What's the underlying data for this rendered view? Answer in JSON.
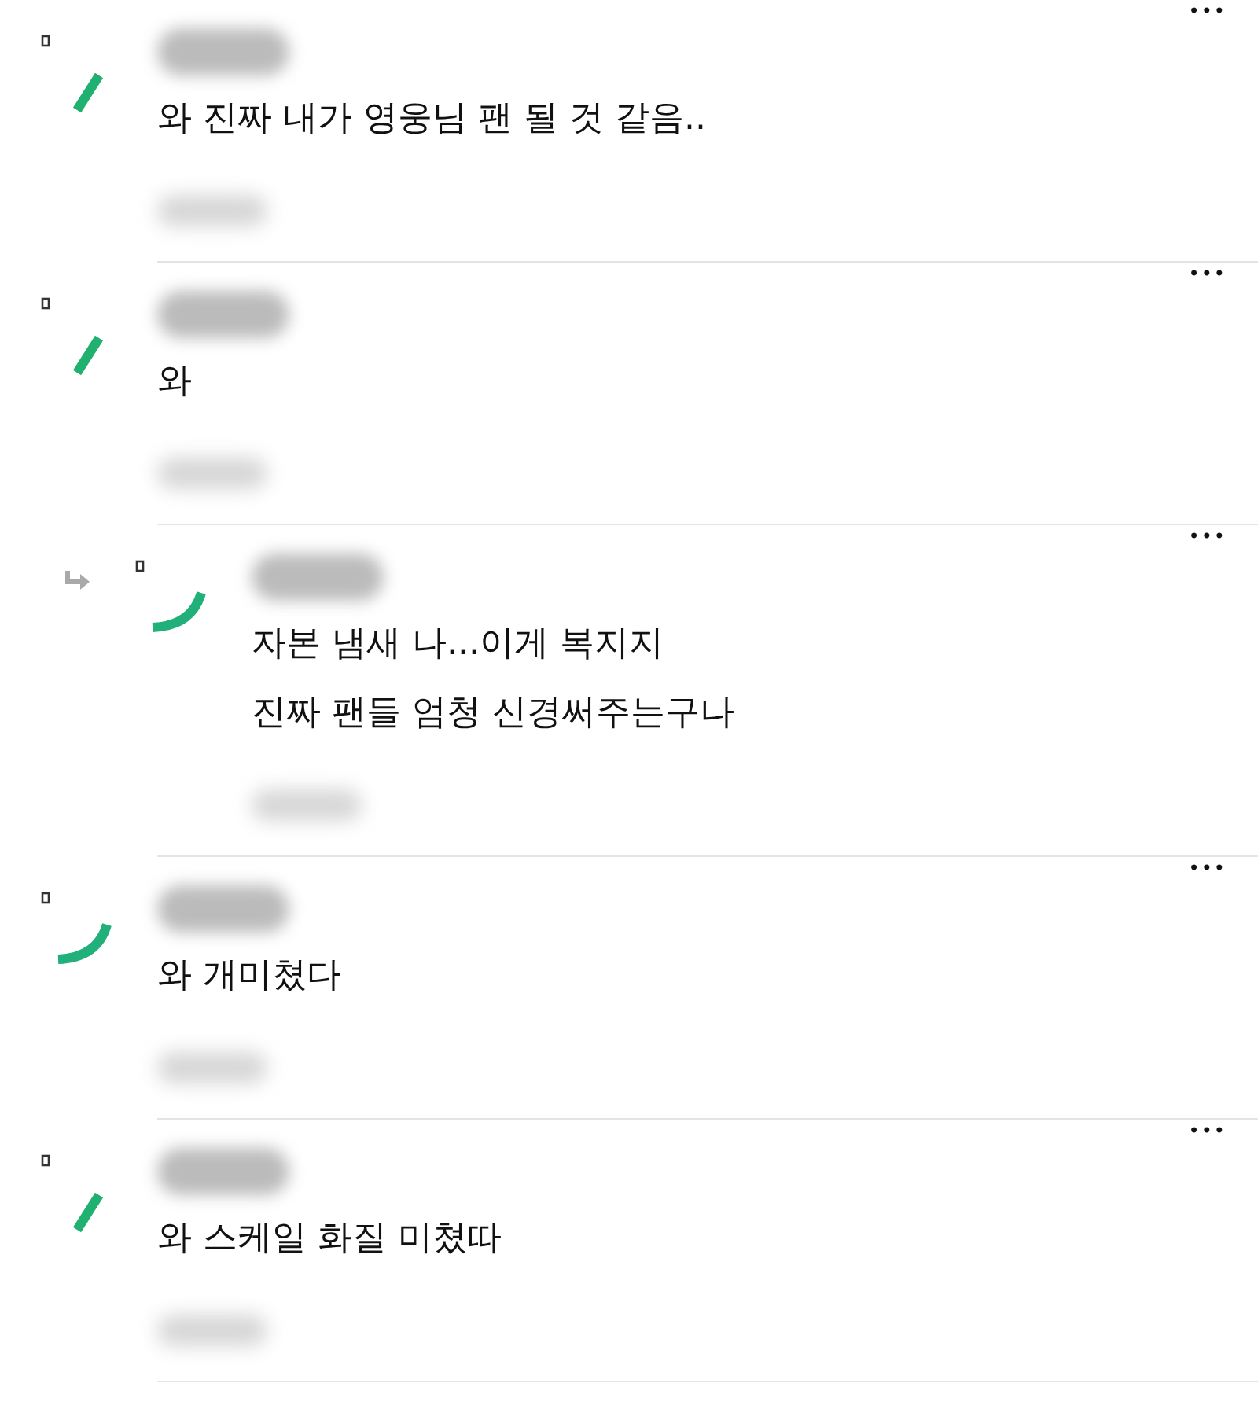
{
  "comments": [
    {
      "reply": false,
      "kind": "dash",
      "lines": [
        "와 진짜 내가 영웅님 팬 될 것 같음.."
      ],
      "more": "•••"
    },
    {
      "reply": false,
      "kind": "dash",
      "lines": [
        "와"
      ],
      "more": "•••"
    },
    {
      "reply": true,
      "kind": "arc",
      "lines": [
        "자본 냄새 나...이게 복지지",
        "진짜 팬들 엄청 신경써주는구나"
      ],
      "more": "•••"
    },
    {
      "reply": false,
      "kind": "arc",
      "lines": [
        "와 개미쳤다"
      ],
      "more": "•••"
    },
    {
      "reply": false,
      "kind": "dash",
      "lines": [
        "와 스케일 화질 미쳤따"
      ],
      "more": "•••"
    }
  ]
}
